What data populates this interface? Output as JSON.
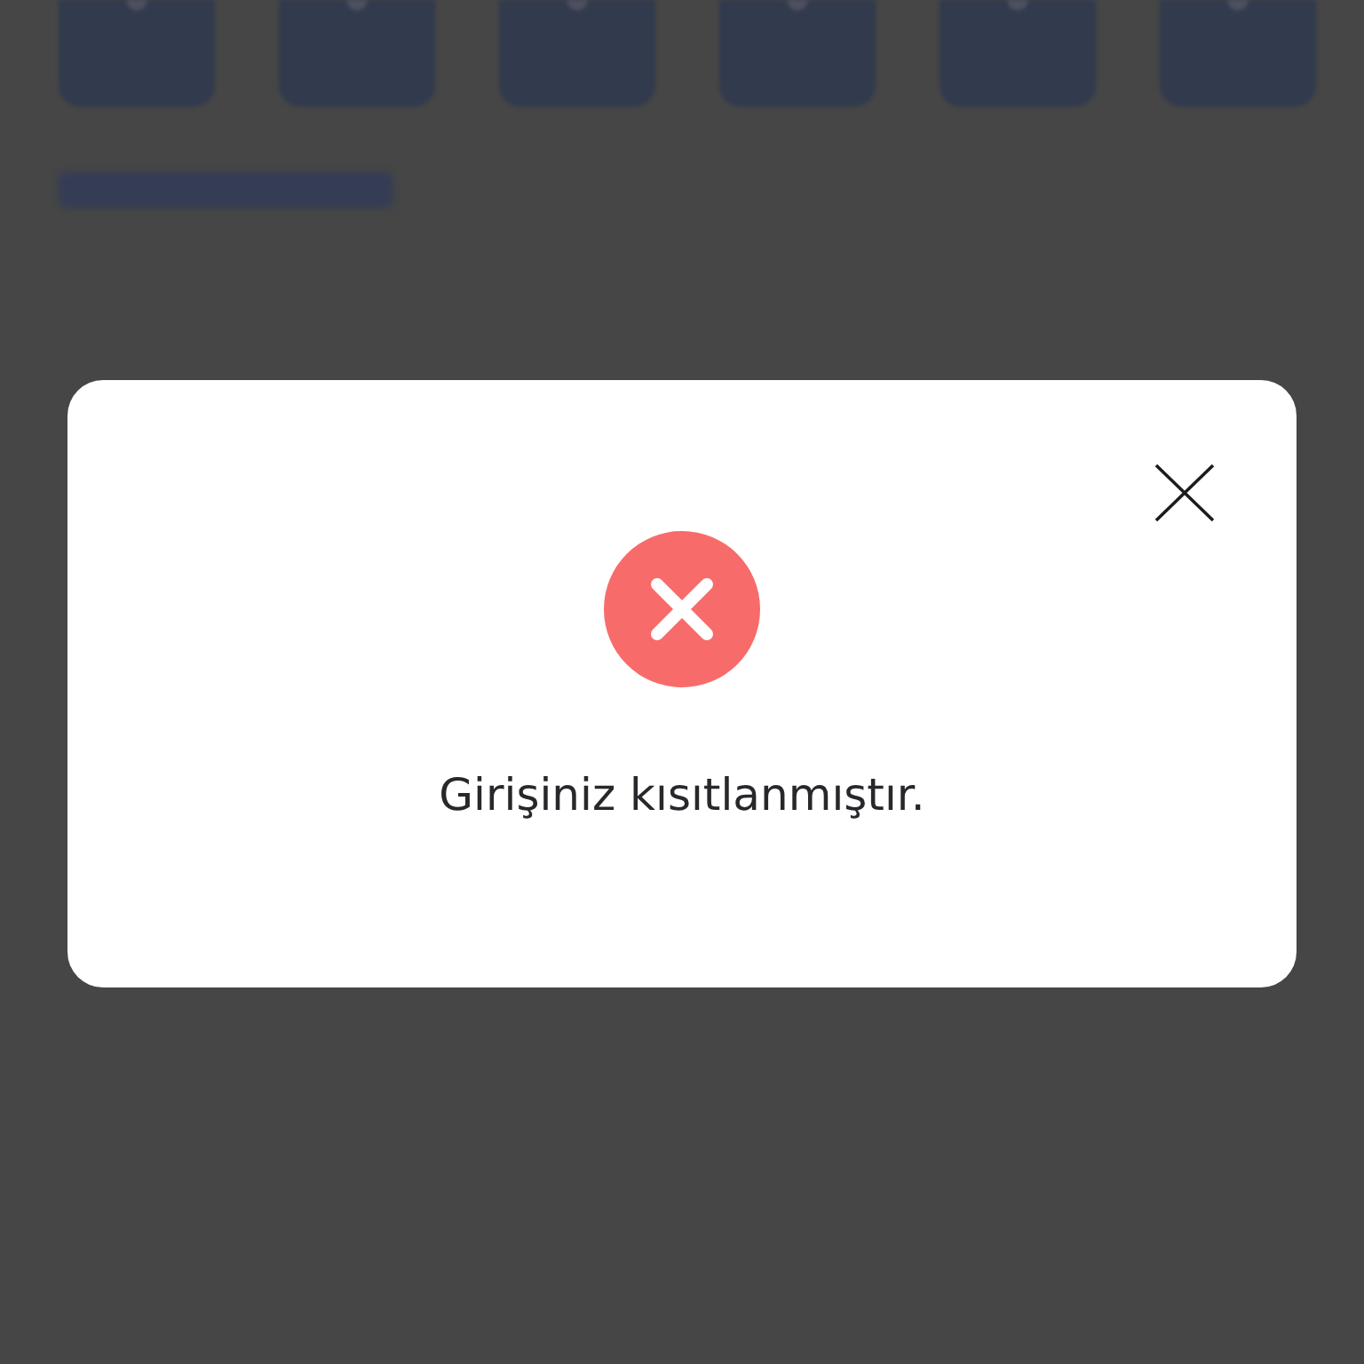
{
  "dialog": {
    "message": "Girişiniz kısıtlanmıştır."
  }
}
